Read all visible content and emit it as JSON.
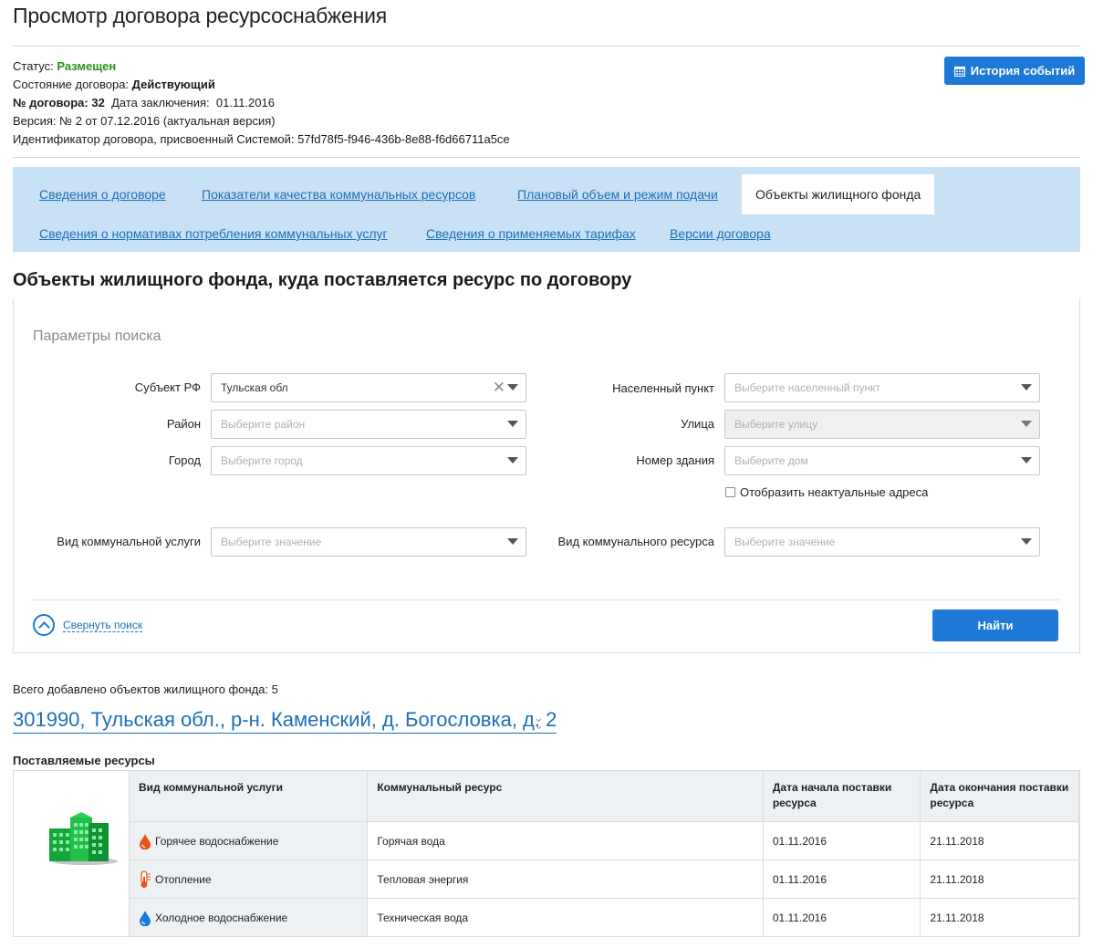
{
  "page": {
    "title": "Просмотр договора ресурсоснабжения"
  },
  "meta": {
    "status_label": "Статус:",
    "status_value": "Размещен",
    "state_label": "Состояние договора:",
    "state_value": "Действующий",
    "number_label": "№ договора: 32",
    "date_label": "Дата заключения:",
    "date_value": "01.11.2016",
    "version": "Версия: № 2 от 07.12.2016 (актуальная версия)",
    "identifier": "Идентификатор договора, присвоенный Системой: 57fd78f5-f946-436b-8e88-f6d66711a5ce",
    "history_button": "История событий"
  },
  "tabs": [
    {
      "label": "Сведения о договоре",
      "active": false
    },
    {
      "label": "Показатели качества коммунальных ресурсов",
      "active": false
    },
    {
      "label": "Плановый объем и режим подачи",
      "active": false
    },
    {
      "label": "Объекты жилищного фонда",
      "active": true
    },
    {
      "label": "Сведения о нормативах потребления коммунальных услуг",
      "active": false
    },
    {
      "label": "Сведения о применяемых тарифах",
      "active": false
    },
    {
      "label": "Версии договора",
      "active": false
    }
  ],
  "section_title": "Объекты жилищного фонда, куда поставляется ресурс по договору",
  "search": {
    "header": "Параметры поиска",
    "subject_label": "Субъект РФ",
    "subject_value": "Тульская обл",
    "district_label": "Район",
    "district_placeholder": "Выберите район",
    "city_label": "Город",
    "city_placeholder": "Выберите город",
    "locality_label": "Населенный пункт",
    "locality_placeholder": "Выберите населенный пункт",
    "street_label": "Улица",
    "street_placeholder": "Выберите улицу",
    "building_label": "Номер здания",
    "building_placeholder": "Выберите дом",
    "show_outdated": "Отобразить неактуальные адреса",
    "service_label": "Вид коммунальной услуги",
    "service_placeholder": "Выберите значение",
    "resource_label": "Вид коммунального ресурса",
    "resource_placeholder": "Выберите значение",
    "collapse_label": "Свернуть поиск",
    "find_button": "Найти"
  },
  "results": {
    "total": "Всего добавлено объектов жилищного фонда: 5",
    "address": "301990, Тульская обл., р-н. Каменский, д. Богословка, д. 2",
    "resources_title": "Поставляемые ресурсы",
    "columns": [
      "Вид коммунальной услуги",
      "Коммунальный ресурс",
      "Дата начала поставки ресурса",
      "Дата окончания поставки ресурса"
    ],
    "rows": [
      {
        "service": "Горячее водоснабжение",
        "icon": "hot-water-drop-icon",
        "resource": "Горячая вода",
        "start": "01.11.2016",
        "end": "21.11.2018"
      },
      {
        "service": "Отопление",
        "icon": "thermometer-icon",
        "resource": "Тепловая энергия",
        "start": "01.11.2016",
        "end": "21.11.2018"
      },
      {
        "service": "Холодное водоснабжение",
        "icon": "cold-water-drop-icon",
        "resource": "Техническая вода",
        "start": "01.11.2016",
        "end": "21.11.2018"
      }
    ]
  },
  "colors": {
    "accent": "#1d78d6",
    "link": "#1d6fb8",
    "status_green": "#2f8f1f",
    "tab_bar": "#c9e1f5",
    "hot_water": "#e8531a",
    "cold_water": "#1d78d6"
  }
}
